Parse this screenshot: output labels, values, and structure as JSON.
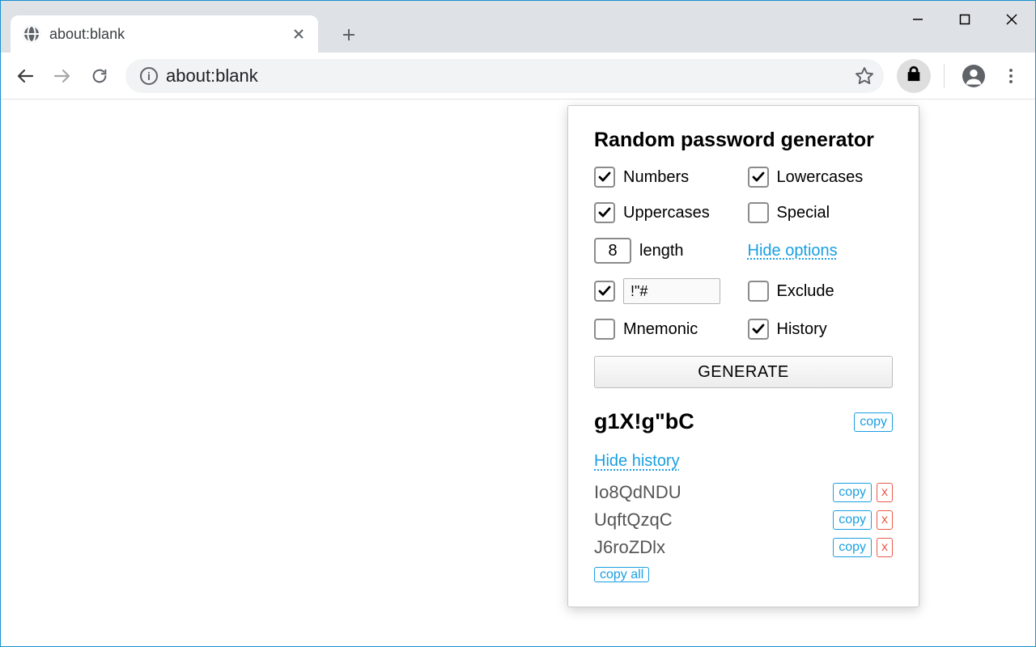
{
  "browser": {
    "tab_title": "about:blank",
    "url": "about:blank"
  },
  "popup": {
    "title": "Random password generator",
    "options": {
      "numbers_label": "Numbers",
      "numbers_checked": true,
      "lowercases_label": "Lowercases",
      "lowercases_checked": true,
      "uppercases_label": "Uppercases",
      "uppercases_checked": true,
      "special_label": "Special",
      "special_checked": false,
      "length_value": "8",
      "length_label": "length",
      "hide_options_label": "Hide options",
      "inclusion_checked": true,
      "inclusion_value": "!\"#",
      "exclude_label": "Exclude",
      "exclude_checked": false,
      "mnemonic_label": "Mnemonic",
      "mnemonic_checked": false,
      "history_label": "History",
      "history_checked": true
    },
    "generate_label": "GENERATE",
    "generated": "g1X!g\"bC",
    "copy_label": "copy",
    "hide_history_label": "Hide history",
    "delete_label": "x",
    "copy_all_label": "copy all",
    "history": [
      "Io8QdNDU",
      "UqftQzqC",
      "J6roZDlx"
    ]
  }
}
